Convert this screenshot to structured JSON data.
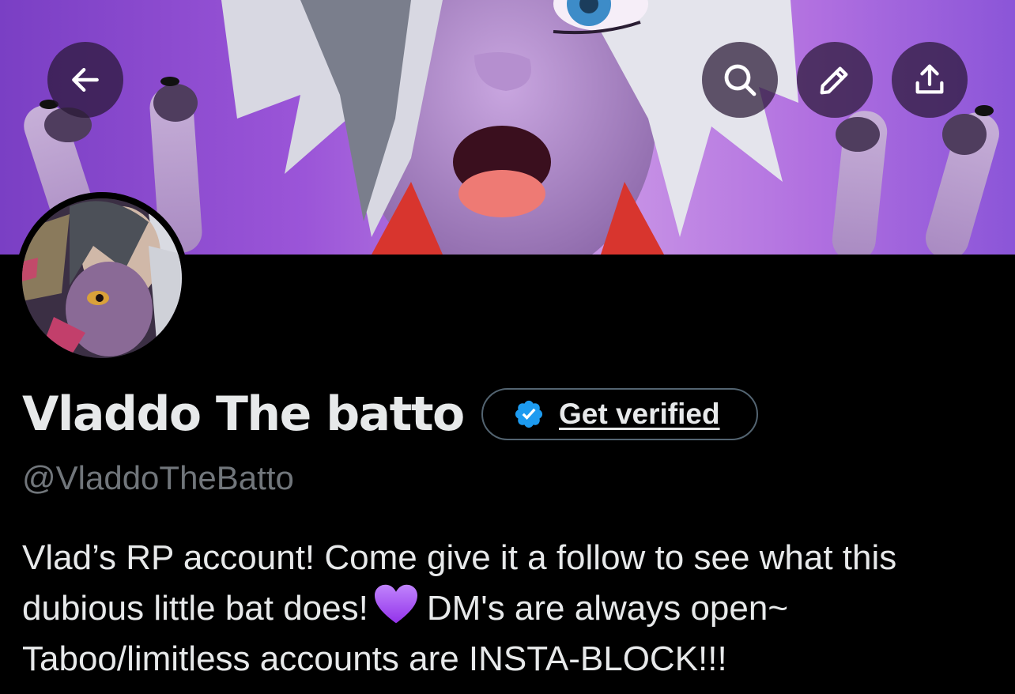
{
  "header": {
    "back_icon": "arrow-left-icon",
    "search_icon": "search-icon",
    "edit_icon": "pencil-icon",
    "share_icon": "share-upload-icon"
  },
  "profile": {
    "display_name": "Vladdo The batto",
    "handle": "@VladdoTheBatto",
    "verify": {
      "label": "Get verified",
      "badge_icon": "verified-badge-icon",
      "badge_color": "#1d9bf0"
    },
    "bio": {
      "line1": "Vlad’s RP account! Come give it a follow to see what this",
      "line2a": "dubious little bat does!",
      "emoji": "purple-heart-icon",
      "line2b": "DM's are always open~",
      "line3": "Taboo/limitless accounts are INSTA-BLOCK!!!"
    }
  },
  "theme": {
    "background": "#000000",
    "text_primary": "#e7e9ea",
    "text_secondary": "#71767b",
    "accent": "#1d9bf0",
    "heart": "#a855f7"
  }
}
